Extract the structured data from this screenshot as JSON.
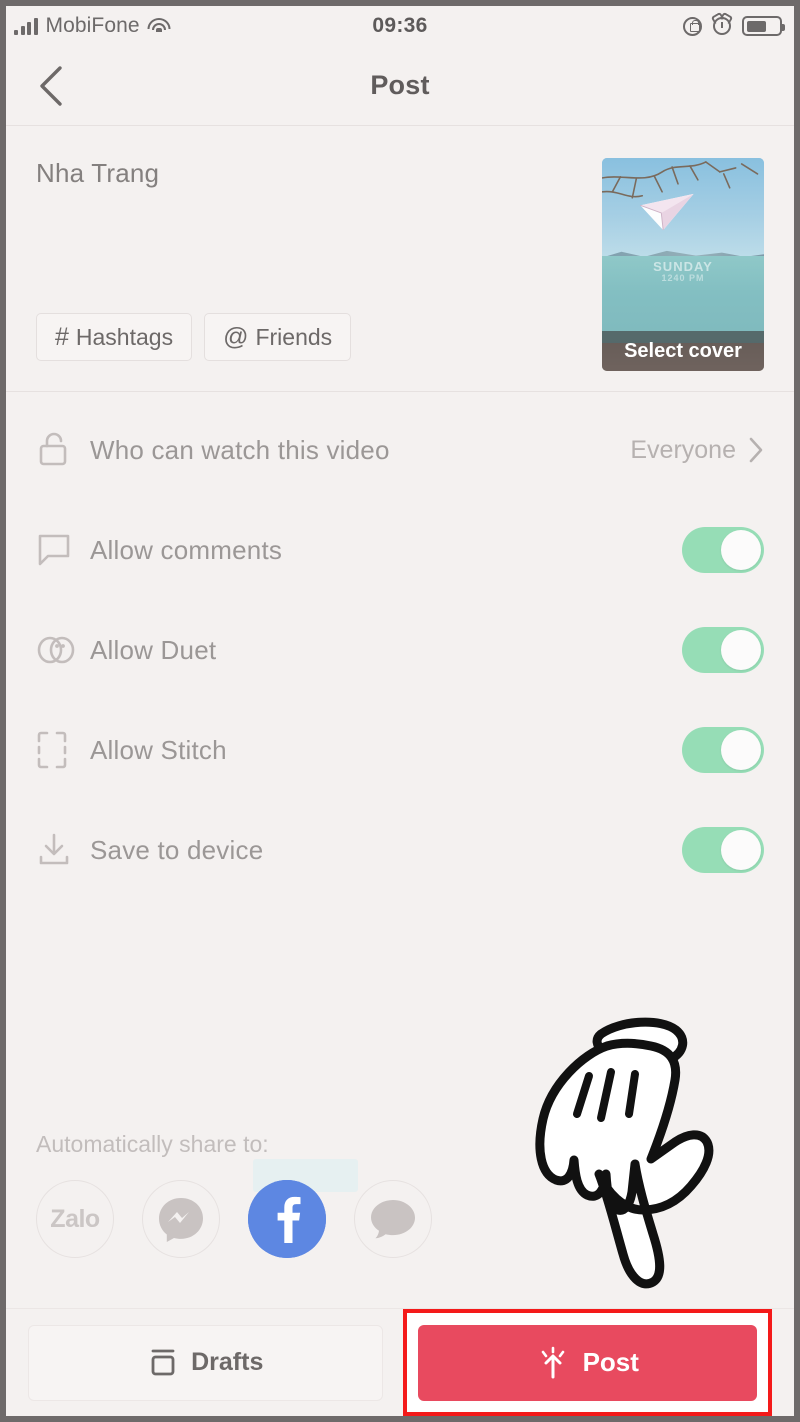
{
  "status_bar": {
    "carrier": "MobiFone",
    "time": "09:36",
    "icons": [
      "signal-bars-icon",
      "wifi-icon",
      "rotation-lock-icon",
      "alarm-clock-icon",
      "battery-icon"
    ]
  },
  "nav": {
    "back_icon": "chevron-left-icon",
    "title": "Post"
  },
  "caption": {
    "text": "Nha Trang",
    "tags": [
      {
        "glyph": "#",
        "label": "Hashtags",
        "icon": "hashtag-icon"
      },
      {
        "glyph": "@",
        "label": "Friends",
        "icon": "at-mention-icon"
      }
    ],
    "cover": {
      "label": "Select cover",
      "overlay_text": "SUNDAY",
      "overlay_subtext": "1240 PM"
    }
  },
  "settings": {
    "privacy": {
      "icon": "unlock-icon",
      "label": "Who can watch this video",
      "value": "Everyone",
      "chevron": "chevron-right-icon"
    },
    "toggles": [
      {
        "icon": "comment-bubble-icon",
        "label": "Allow comments",
        "on": true
      },
      {
        "icon": "duet-icon",
        "label": "Allow Duet",
        "on": true
      },
      {
        "icon": "stitch-icon",
        "label": "Allow Stitch",
        "on": true
      },
      {
        "icon": "download-icon",
        "label": "Save to device",
        "on": true
      }
    ]
  },
  "share": {
    "title": "Automatically share to:",
    "items": [
      {
        "name": "zalo",
        "label": "Zalo",
        "active": false
      },
      {
        "name": "messenger",
        "label": "",
        "active": false
      },
      {
        "name": "facebook",
        "label": "",
        "active": true
      },
      {
        "name": "sms",
        "label": "",
        "active": false
      }
    ]
  },
  "bottom": {
    "drafts_label": "Drafts",
    "drafts_icon": "archive-box-icon",
    "post_label": "Post",
    "post_icon": "upload-sparkle-icon"
  },
  "colors": {
    "background": "#f4f1f0",
    "toggle_on": "#96ddb6",
    "post_button": "#e84a5f",
    "facebook_blue": "#5d87e2",
    "annotation_red": "#f41a1a",
    "text_muted": "#9b9796"
  },
  "annotation": {
    "highlight_target": "post-button"
  }
}
